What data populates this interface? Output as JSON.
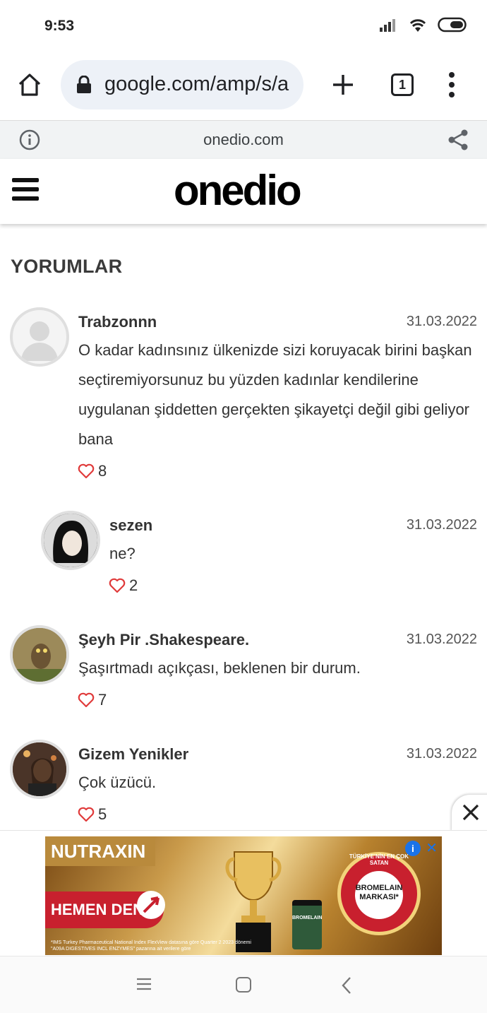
{
  "status_bar": {
    "time": "9:53"
  },
  "browser": {
    "url": "google.com/amp/s/a",
    "tab_count": "1",
    "amp_domain": "onedio.com"
  },
  "site": {
    "logo": "onedio"
  },
  "comments_section": {
    "title": "YORUMLAR",
    "comments": [
      {
        "user": "Trabzonnn",
        "date": "31.03.2022",
        "text": "O kadar kadınsınız ülkenizde sizi koruyacak birini başkan seçtiremiyorsunuz bu yüzden kadınlar kendilerine uygulanan şiddetten gerçekten şikayetçi değil gibi geliyor bana",
        "likes": "8"
      },
      {
        "user": "sezen",
        "date": "31.03.2022",
        "text": "ne?",
        "likes": "2"
      },
      {
        "user": "Şeyh Pir .Shakespeare.",
        "date": "31.03.2022",
        "text": "Şaşırtmadı açıkçası, beklenen bir durum.",
        "likes": "7"
      },
      {
        "user": "Gizem Yenikler",
        "date": "31.03.2022",
        "text": "Çok üzücü.",
        "likes": "5"
      }
    ]
  },
  "ad": {
    "brand": "NUTRAXIN",
    "cta": "HEMEN DENE",
    "badge_arc": "TÜRKİYE'NİN EN ÇOK SATAN",
    "badge_main": "BROMELAIN MARKASI*",
    "bottle_label": "BROMELAIN",
    "fine_print": "*IMS Turkey Pharmaceutical National Index FlexView datasına göre Quarter 2 2023 dönemi \"A09A DIGESTIVES INCL ENZYMES\" pazarına ait verilere göre"
  },
  "colors": {
    "like_heart": "#e03a3a",
    "ad_red": "#c8202e",
    "ad_gold": "#b98a3c"
  }
}
